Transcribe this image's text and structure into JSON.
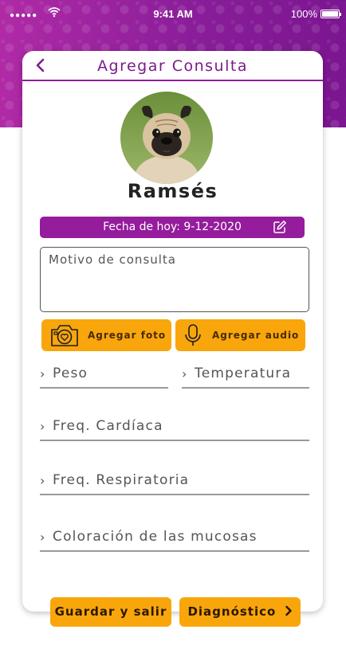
{
  "status_bar": {
    "time": "9:41 AM",
    "battery": "100%"
  },
  "header": {
    "title": "Agregar Consulta"
  },
  "pet": {
    "name": "Ramsés"
  },
  "date_bar": {
    "label": "Fecha de hoy: 9-12-2020"
  },
  "motivo": {
    "placeholder": "Motivo de consulta"
  },
  "buttons": {
    "photo": "Agregar foto",
    "audio": "Agregar audio",
    "save": "Guardar y salir",
    "diagnosis": "Diagnóstico"
  },
  "fields": {
    "peso": "Peso",
    "temperatura": "Temperatura",
    "freq_cardiaca": "Freq. Cardíaca",
    "freq_respiratoria": "Freq. Respiratoria",
    "coloracion": "Coloración de las mucosas"
  },
  "icons": {
    "back": "chevron-left-icon",
    "edit": "edit-icon",
    "camera": "camera-icon",
    "microphone": "microphone-icon",
    "field_chevron": "chevron-right-icon",
    "next": "chevron-right-icon"
  },
  "colors": {
    "primary": "#951c9c",
    "accent": "#f8a60c"
  }
}
